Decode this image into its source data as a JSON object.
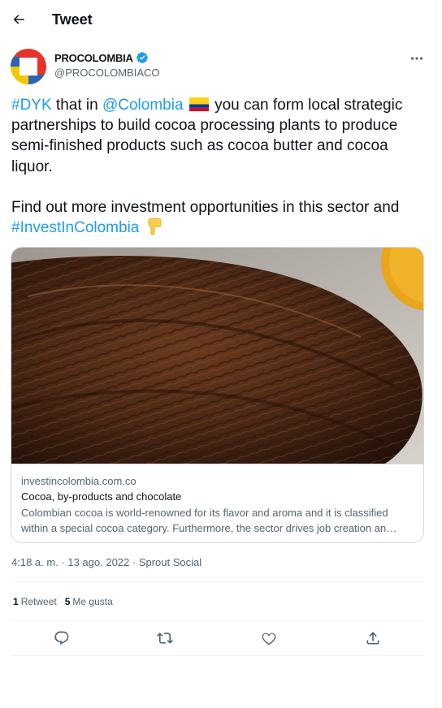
{
  "header": {
    "title": "Tweet",
    "back_icon": "arrow-left-icon"
  },
  "author": {
    "display_name": "PROCOLOMBIA",
    "handle": "@PROCOLOMBIACO",
    "verified_icon": "verified-badge-icon",
    "avatar_colors": [
      "#e63329",
      "#f7c600",
      "#2b63b6",
      "#ffffff"
    ]
  },
  "more_icon": "more-horizontal-icon",
  "tweet": {
    "hashtag_dyk": "#DYK",
    "text_1": " that in ",
    "mention": "@Colombia",
    "flag_icon": "colombia-flag-icon",
    "text_2": " you can form local strategic partnerships to build cocoa processing plants to produce semi-finished products such as cocoa butter and cocoa liquor.",
    "text_3": "Find out more investment opportunities in this sector and ",
    "hashtag_invest": "#InvestInColombia",
    "pointing_icon": "pointing-down-emoji-icon",
    "link_color": "#1d9bf0"
  },
  "card": {
    "image_subject": "cocoa-pod-photo",
    "domain": "investincolombia.com.co",
    "title": "Cocoa, by-products and chocolate",
    "description": "Colombian cocoa is world-renowned for its flavor and aroma and it is classified within a special cocoa category. Furthermore, the sector drives job creation an…"
  },
  "meta": {
    "timestamp": "4:18 a. m. · 13 ago. 2022 · Sprout Social"
  },
  "stats": {
    "retweets_count": "1",
    "retweets_label": "Retweet",
    "likes_count": "5",
    "likes_label": "Me gusta"
  },
  "actions": [
    "reply-icon",
    "retweet-icon",
    "like-icon",
    "share-icon"
  ]
}
